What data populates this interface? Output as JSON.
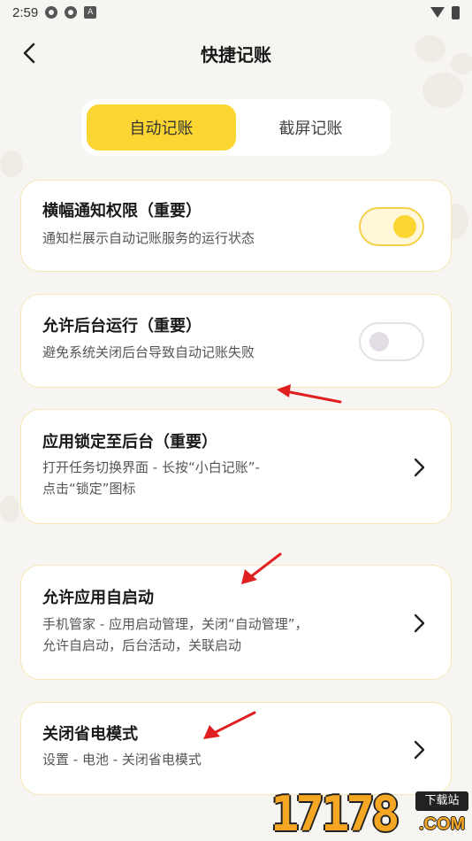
{
  "status_bar": {
    "time": "2:59"
  },
  "header": {
    "title": "快捷记账",
    "back_icon": "chevron-left-icon"
  },
  "tabs": [
    {
      "label": "自动记账",
      "active": true
    },
    {
      "label": "截屏记账",
      "active": false
    }
  ],
  "cards": [
    {
      "title": "横幅通知权限（重要）",
      "desc": [
        "通知栏展示自动记账服务的运行状态"
      ],
      "control": "toggle",
      "on": true
    },
    {
      "title": "允许后台运行（重要）",
      "desc": [
        "避免系统关闭后台导致自动记账失败"
      ],
      "control": "toggle",
      "on": false
    },
    {
      "title": "应用锁定至后台（重要）",
      "desc": [
        "打开任务切换界面 - 长按“小白记账”-",
        "点击“锁定”图标"
      ],
      "control": "chevron"
    },
    {
      "title": "允许应用自启动",
      "desc": [
        "手机管家 - 应用启动管理，关闭“自动管理”，",
        "允许自启动，后台活动，关联启动"
      ],
      "control": "chevron"
    },
    {
      "title": "关闭省电模式",
      "desc": [
        "设置 - 电池 - 关闭省电模式"
      ],
      "control": "chevron"
    }
  ],
  "watermark": {
    "number": "17178",
    "tag": "下载站",
    "domain": ".COM"
  },
  "colors": {
    "accent": "#fbd633",
    "arrow": "#e02020",
    "background": "#f7f5f1"
  }
}
